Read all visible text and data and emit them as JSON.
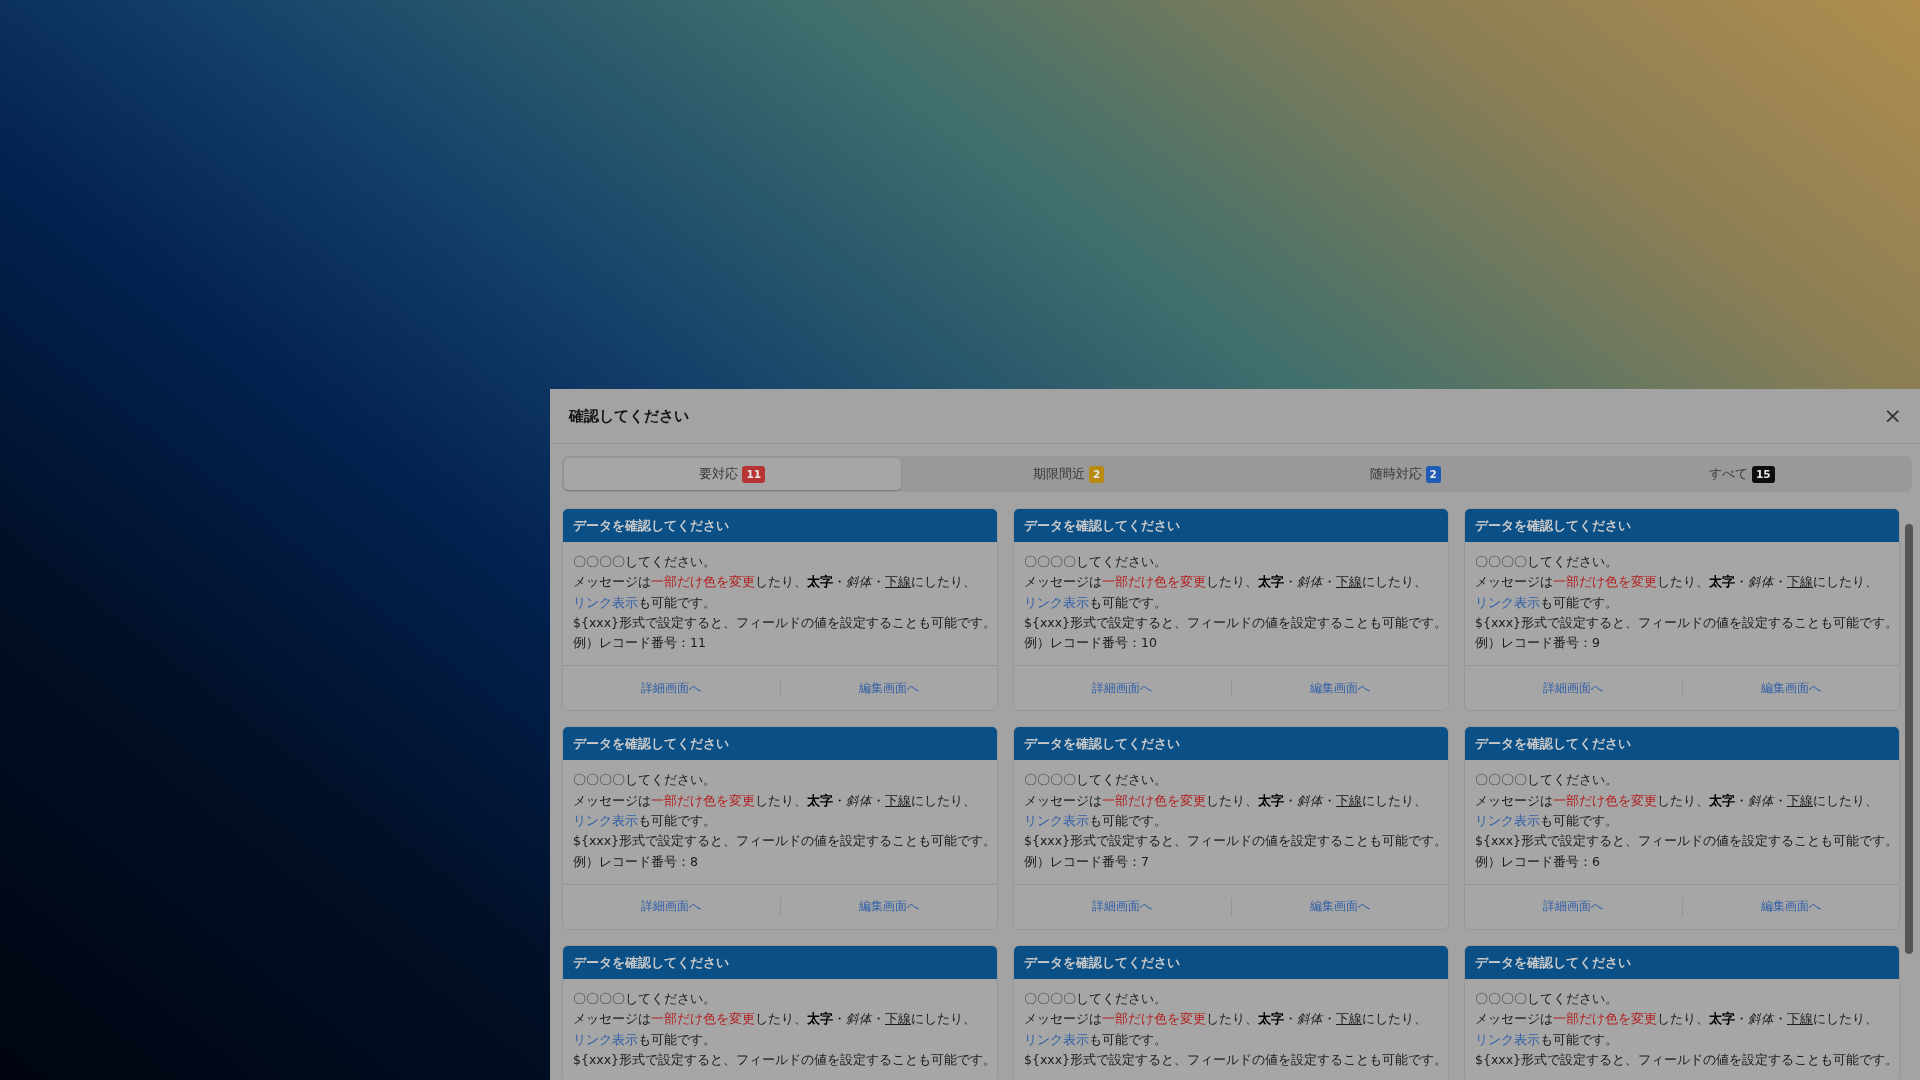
{
  "dialog": {
    "title": "確認してください",
    "close": "×"
  },
  "tabs": [
    {
      "label": "要対応",
      "badge": "11",
      "color": "#b73434",
      "selected": true
    },
    {
      "label": "期限間近",
      "badge": "2",
      "color": "#b98a12",
      "selected": false
    },
    {
      "label": "随時対応",
      "badge": "2",
      "color": "#1f5cb5",
      "selected": false
    },
    {
      "label": "すべて",
      "badge": "15",
      "color": "#0d0d0d",
      "selected": false
    }
  ],
  "cards": [
    {
      "title": "データを確認してください",
      "lines": [
        [
          {
            "text": "〇〇〇〇してください。",
            "kind": "plain"
          }
        ],
        [
          {
            "text": "メッセージは",
            "kind": "plain"
          },
          {
            "text": "一部だけ色を変更",
            "kind": "red"
          },
          {
            "text": "したり、",
            "kind": "plain"
          },
          {
            "text": "太字",
            "kind": "bold"
          },
          {
            "text": "・",
            "kind": "plain"
          },
          {
            "text": "斜体",
            "kind": "italic"
          },
          {
            "text": "・",
            "kind": "plain"
          },
          {
            "text": "下線",
            "kind": "underline"
          },
          {
            "text": "にしたり、",
            "kind": "plain"
          }
        ],
        [
          {
            "text": "リンク表示",
            "kind": "link"
          },
          {
            "text": "も可能です。",
            "kind": "plain"
          }
        ],
        [
          {
            "text": "${xxx}形式で設定すると、フィールドの値を設定することも可能です。",
            "kind": "plain"
          }
        ],
        [
          {
            "text": "例）レコード番号：11",
            "kind": "plain"
          }
        ]
      ],
      "buttons": [
        "詳細画面へ",
        "編集画面へ"
      ]
    },
    {
      "title": "データを確認してください",
      "lines": [
        [
          {
            "text": "〇〇〇〇してください。",
            "kind": "plain"
          }
        ],
        [
          {
            "text": "メッセージは",
            "kind": "plain"
          },
          {
            "text": "一部だけ色を変更",
            "kind": "red"
          },
          {
            "text": "したり、",
            "kind": "plain"
          },
          {
            "text": "太字",
            "kind": "bold"
          },
          {
            "text": "・",
            "kind": "plain"
          },
          {
            "text": "斜体",
            "kind": "italic"
          },
          {
            "text": "・",
            "kind": "plain"
          },
          {
            "text": "下線",
            "kind": "underline"
          },
          {
            "text": "にしたり、",
            "kind": "plain"
          }
        ],
        [
          {
            "text": "リンク表示",
            "kind": "link"
          },
          {
            "text": "も可能です。",
            "kind": "plain"
          }
        ],
        [
          {
            "text": "${xxx}形式で設定すると、フィールドの値を設定することも可能です。",
            "kind": "plain"
          }
        ],
        [
          {
            "text": "例）レコード番号：10",
            "kind": "plain"
          }
        ]
      ],
      "buttons": [
        "詳細画面へ",
        "編集画面へ"
      ]
    },
    {
      "title": "データを確認してください",
      "lines": [
        [
          {
            "text": "〇〇〇〇してください。",
            "kind": "plain"
          }
        ],
        [
          {
            "text": "メッセージは",
            "kind": "plain"
          },
          {
            "text": "一部だけ色を変更",
            "kind": "red"
          },
          {
            "text": "したり、",
            "kind": "plain"
          },
          {
            "text": "太字",
            "kind": "bold"
          },
          {
            "text": "・",
            "kind": "plain"
          },
          {
            "text": "斜体",
            "kind": "italic"
          },
          {
            "text": "・",
            "kind": "plain"
          },
          {
            "text": "下線",
            "kind": "underline"
          },
          {
            "text": "にしたり、",
            "kind": "plain"
          }
        ],
        [
          {
            "text": "リンク表示",
            "kind": "link"
          },
          {
            "text": "も可能です。",
            "kind": "plain"
          }
        ],
        [
          {
            "text": "${xxx}形式で設定すると、フィールドの値を設定することも可能です。",
            "kind": "plain"
          }
        ],
        [
          {
            "text": "例）レコード番号：9",
            "kind": "plain"
          }
        ]
      ],
      "buttons": [
        "詳細画面へ",
        "編集画面へ"
      ]
    },
    {
      "title": "データを確認してください",
      "lines": [
        [
          {
            "text": "〇〇〇〇してください。",
            "kind": "plain"
          }
        ],
        [
          {
            "text": "メッセージは",
            "kind": "plain"
          },
          {
            "text": "一部だけ色を変更",
            "kind": "red"
          },
          {
            "text": "したり、",
            "kind": "plain"
          },
          {
            "text": "太字",
            "kind": "bold"
          },
          {
            "text": "・",
            "kind": "plain"
          },
          {
            "text": "斜体",
            "kind": "italic"
          },
          {
            "text": "・",
            "kind": "plain"
          },
          {
            "text": "下線",
            "kind": "underline"
          },
          {
            "text": "にしたり、",
            "kind": "plain"
          }
        ],
        [
          {
            "text": "リンク表示",
            "kind": "link"
          },
          {
            "text": "も可能です。",
            "kind": "plain"
          }
        ],
        [
          {
            "text": "${xxx}形式で設定すると、フィールドの値を設定することも可能です。",
            "kind": "plain"
          }
        ],
        [
          {
            "text": "例）レコード番号：8",
            "kind": "plain"
          }
        ]
      ],
      "buttons": [
        "詳細画面へ",
        "編集画面へ"
      ]
    },
    {
      "title": "データを確認してください",
      "lines": [
        [
          {
            "text": "〇〇〇〇してください。",
            "kind": "plain"
          }
        ],
        [
          {
            "text": "メッセージは",
            "kind": "plain"
          },
          {
            "text": "一部だけ色を変更",
            "kind": "red"
          },
          {
            "text": "したり、",
            "kind": "plain"
          },
          {
            "text": "太字",
            "kind": "bold"
          },
          {
            "text": "・",
            "kind": "plain"
          },
          {
            "text": "斜体",
            "kind": "italic"
          },
          {
            "text": "・",
            "kind": "plain"
          },
          {
            "text": "下線",
            "kind": "underline"
          },
          {
            "text": "にしたり、",
            "kind": "plain"
          }
        ],
        [
          {
            "text": "リンク表示",
            "kind": "link"
          },
          {
            "text": "も可能です。",
            "kind": "plain"
          }
        ],
        [
          {
            "text": "${xxx}形式で設定すると、フィールドの値を設定することも可能です。",
            "kind": "plain"
          }
        ],
        [
          {
            "text": "例）レコード番号：7",
            "kind": "plain"
          }
        ]
      ],
      "buttons": [
        "詳細画面へ",
        "編集画面へ"
      ]
    },
    {
      "title": "データを確認してください",
      "lines": [
        [
          {
            "text": "〇〇〇〇してください。",
            "kind": "plain"
          }
        ],
        [
          {
            "text": "メッセージは",
            "kind": "plain"
          },
          {
            "text": "一部だけ色を変更",
            "kind": "red"
          },
          {
            "text": "したり、",
            "kind": "plain"
          },
          {
            "text": "太字",
            "kind": "bold"
          },
          {
            "text": "・",
            "kind": "plain"
          },
          {
            "text": "斜体",
            "kind": "italic"
          },
          {
            "text": "・",
            "kind": "plain"
          },
          {
            "text": "下線",
            "kind": "underline"
          },
          {
            "text": "にしたり、",
            "kind": "plain"
          }
        ],
        [
          {
            "text": "リンク表示",
            "kind": "link"
          },
          {
            "text": "も可能です。",
            "kind": "plain"
          }
        ],
        [
          {
            "text": "${xxx}形式で設定すると、フィールドの値を設定することも可能です。",
            "kind": "plain"
          }
        ],
        [
          {
            "text": "例）レコード番号：6",
            "kind": "plain"
          }
        ]
      ],
      "buttons": [
        "詳細画面へ",
        "編集画面へ"
      ]
    },
    {
      "title": "データを確認してください",
      "lines": [
        [
          {
            "text": "〇〇〇〇してください。",
            "kind": "plain"
          }
        ],
        [
          {
            "text": "メッセージは",
            "kind": "plain"
          },
          {
            "text": "一部だけ色を変更",
            "kind": "red"
          },
          {
            "text": "したり、",
            "kind": "plain"
          },
          {
            "text": "太字",
            "kind": "bold"
          },
          {
            "text": "・",
            "kind": "plain"
          },
          {
            "text": "斜体",
            "kind": "italic"
          },
          {
            "text": "・",
            "kind": "plain"
          },
          {
            "text": "下線",
            "kind": "underline"
          },
          {
            "text": "にしたり、",
            "kind": "plain"
          }
        ],
        [
          {
            "text": "リンク表示",
            "kind": "link"
          },
          {
            "text": "も可能です。",
            "kind": "plain"
          }
        ],
        [
          {
            "text": "${xxx}形式で設定すると、フィールドの値を設定することも可能です。",
            "kind": "plain"
          }
        ]
      ]
    },
    {
      "title": "データを確認してください",
      "lines": [
        [
          {
            "text": "〇〇〇〇してください。",
            "kind": "plain"
          }
        ],
        [
          {
            "text": "メッセージは",
            "kind": "plain"
          },
          {
            "text": "一部だけ色を変更",
            "kind": "red"
          },
          {
            "text": "したり、",
            "kind": "plain"
          },
          {
            "text": "太字",
            "kind": "bold"
          },
          {
            "text": "・",
            "kind": "plain"
          },
          {
            "text": "斜体",
            "kind": "italic"
          },
          {
            "text": "・",
            "kind": "plain"
          },
          {
            "text": "下線",
            "kind": "underline"
          },
          {
            "text": "にしたり、",
            "kind": "plain"
          }
        ],
        [
          {
            "text": "リンク表示",
            "kind": "link"
          },
          {
            "text": "も可能です。",
            "kind": "plain"
          }
        ],
        [
          {
            "text": "${xxx}形式で設定すると、フィールドの値を設定することも可能です。",
            "kind": "plain"
          }
        ]
      ]
    },
    {
      "title": "データを確認してください",
      "lines": [
        [
          {
            "text": "〇〇〇〇してください。",
            "kind": "plain"
          }
        ],
        [
          {
            "text": "メッセージは",
            "kind": "plain"
          },
          {
            "text": "一部だけ色を変更",
            "kind": "red"
          },
          {
            "text": "したり、",
            "kind": "plain"
          },
          {
            "text": "太字",
            "kind": "bold"
          },
          {
            "text": "・",
            "kind": "plain"
          },
          {
            "text": "斜体",
            "kind": "italic"
          },
          {
            "text": "・",
            "kind": "plain"
          },
          {
            "text": "下線",
            "kind": "underline"
          },
          {
            "text": "にしたり、",
            "kind": "plain"
          }
        ],
        [
          {
            "text": "リンク表示",
            "kind": "link"
          },
          {
            "text": "も可能です。",
            "kind": "plain"
          }
        ],
        [
          {
            "text": "${xxx}形式で設定すると、フィールドの値を設定することも可能です。",
            "kind": "plain"
          }
        ]
      ]
    }
  ]
}
